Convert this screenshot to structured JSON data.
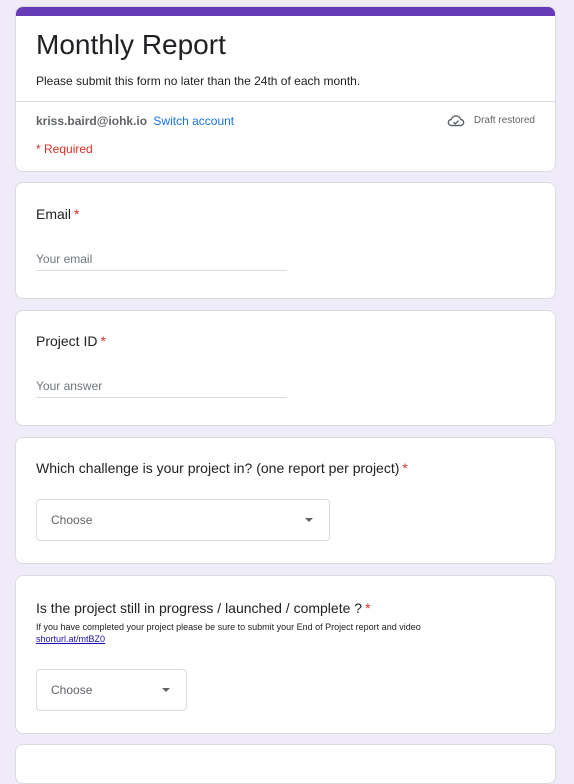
{
  "form": {
    "title": "Monthly Report",
    "description": "Please submit this form no later than the 24th of each month.",
    "account_email": "kriss.baird@iohk.io",
    "switch_account": "Switch account",
    "draft_status": "Draft restored",
    "required_note": "* Required"
  },
  "questions": [
    {
      "title": "Email",
      "required_mark": "*",
      "placeholder": "Your email"
    },
    {
      "title": "Project ID",
      "required_mark": "*",
      "placeholder": "Your answer"
    },
    {
      "title": "Which challenge is your project in? (one report per project)",
      "required_mark": "*",
      "select_value": "Choose"
    },
    {
      "title": "Is the project still in progress / launched / complete ?",
      "required_mark": "*",
      "help": "If you have completed your project please be sure to submit your End of Project report and video",
      "link": "shorturl.at/mtBZ0",
      "select_value": "Choose"
    }
  ],
  "colors": {
    "accent": "#673ab7",
    "background": "#f0ebf8",
    "required": "#d93025",
    "link": "#1a73e8"
  },
  "icons": {
    "draft": "cloud-done-icon",
    "dropdown": "caret-down-icon"
  }
}
